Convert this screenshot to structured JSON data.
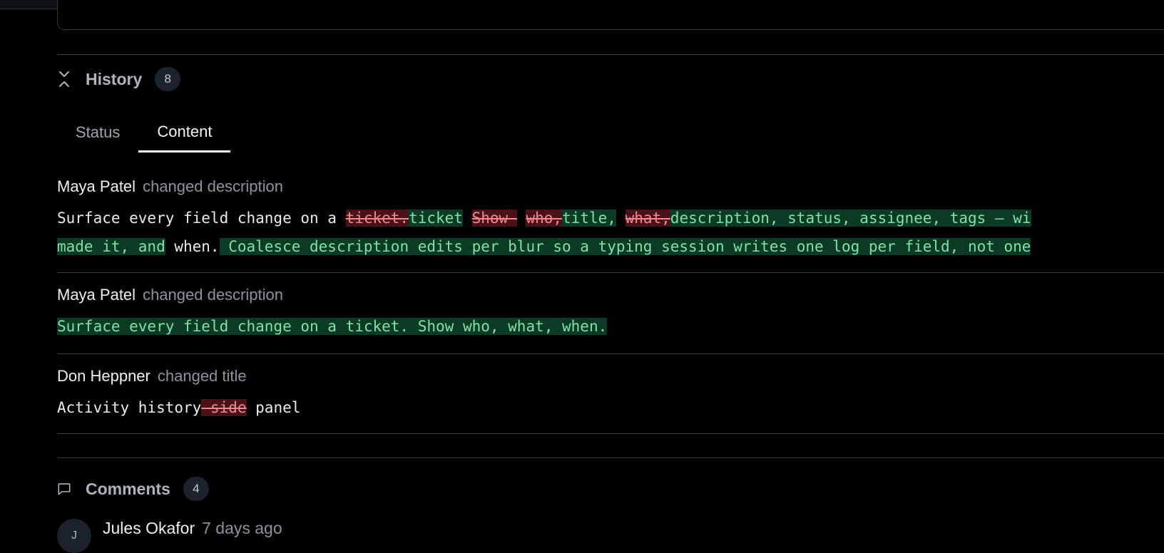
{
  "history": {
    "title": "History",
    "count": "8",
    "icon": "collapse-icon",
    "tabs": [
      {
        "label": "Status",
        "active": false
      },
      {
        "label": "Content",
        "active": true
      }
    ],
    "entries": [
      {
        "author": "Maya Patel",
        "action": "changed description",
        "line1": [
          {
            "t": "Surface every field change on a ",
            "k": "same"
          },
          {
            "t": "ticket.",
            "k": "del"
          },
          {
            "t": "ticket",
            "k": "ins"
          },
          {
            "t": " ",
            "k": "same"
          },
          {
            "t": "Show ",
            "k": "del"
          },
          {
            "t": " ",
            "k": "same"
          },
          {
            "t": "who,",
            "k": "del"
          },
          {
            "t": "title,",
            "k": "ins"
          },
          {
            "t": " ",
            "k": "same"
          },
          {
            "t": "what,",
            "k": "del"
          },
          {
            "t": "description, status, assignee, tags — wi",
            "k": "ins"
          }
        ],
        "line2": [
          {
            "t": "made it, and",
            "k": "ins"
          },
          {
            "t": " when.",
            "k": "same"
          },
          {
            "t": " Coalesce description edits per blur so a typing session writes one log per field, not one",
            "k": "ins"
          }
        ]
      },
      {
        "author": "Maya Patel",
        "action": "changed description",
        "line1": [
          {
            "t": "Surface every field change on a ticket. Show who, what, when.",
            "k": "ins"
          }
        ]
      },
      {
        "author": "Don Heppner",
        "action": "changed title",
        "line1": [
          {
            "t": "Activity history",
            "k": "same"
          },
          {
            "t": " side",
            "k": "del"
          },
          {
            "t": " panel",
            "k": "same"
          }
        ]
      }
    ]
  },
  "comments": {
    "title": "Comments",
    "count": "4",
    "icon": "comment-icon",
    "items": [
      {
        "avatar_initial": "J",
        "author": "Jules Okafor",
        "time": "7 days ago"
      }
    ]
  },
  "colors": {
    "background": "#000000",
    "insert_bg": "#0b3b25",
    "insert_fg": "#7ee2a8",
    "delete_bg": "#4a1118",
    "delete_fg": "#f0878e"
  }
}
